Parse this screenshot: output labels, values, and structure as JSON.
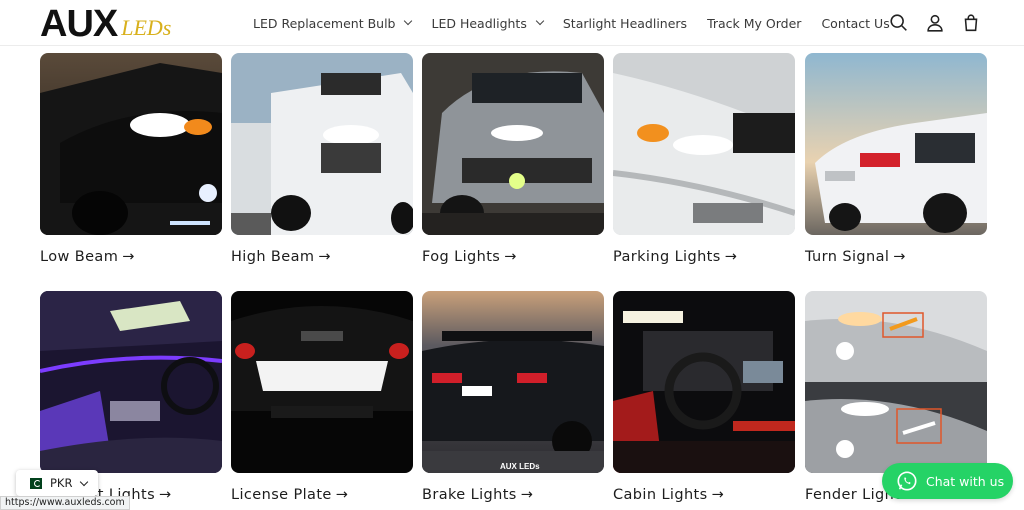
{
  "header": {
    "logo_main": "AUX",
    "logo_sub": "LEDs",
    "nav": [
      {
        "label": "LED Replacement Bulb",
        "has_dropdown": true
      },
      {
        "label": "LED Headlights",
        "has_dropdown": true
      },
      {
        "label": "Starlight Headliners",
        "has_dropdown": false
      },
      {
        "label": "Track My Order",
        "has_dropdown": false
      },
      {
        "label": "Contact Us",
        "has_dropdown": false
      }
    ],
    "icons": [
      "search-icon",
      "account-icon",
      "cart-icon"
    ]
  },
  "categories": [
    {
      "label": "Low Beam",
      "arrow": "→"
    },
    {
      "label": "High Beam",
      "arrow": "→"
    },
    {
      "label": "Fog Lights",
      "arrow": "→"
    },
    {
      "label": "Parking Lights",
      "arrow": "→"
    },
    {
      "label": "Turn Signal",
      "arrow": "→"
    },
    {
      "label": "Ambient Lights",
      "arrow": "→"
    },
    {
      "label": "License Plate",
      "arrow": "→"
    },
    {
      "label": "Brake Lights",
      "arrow": "→"
    },
    {
      "label": "Cabin Lights",
      "arrow": "→"
    },
    {
      "label": "Fender Lights",
      "arrow": "→"
    }
  ],
  "currency": {
    "code": "PKR"
  },
  "status_url": "https://www.auxleds.com",
  "chat": {
    "label": "Chat with us"
  },
  "image_watermark": "AUX LEDs",
  "colors": {
    "accent": "#d8b01c",
    "whatsapp": "#25d366"
  }
}
